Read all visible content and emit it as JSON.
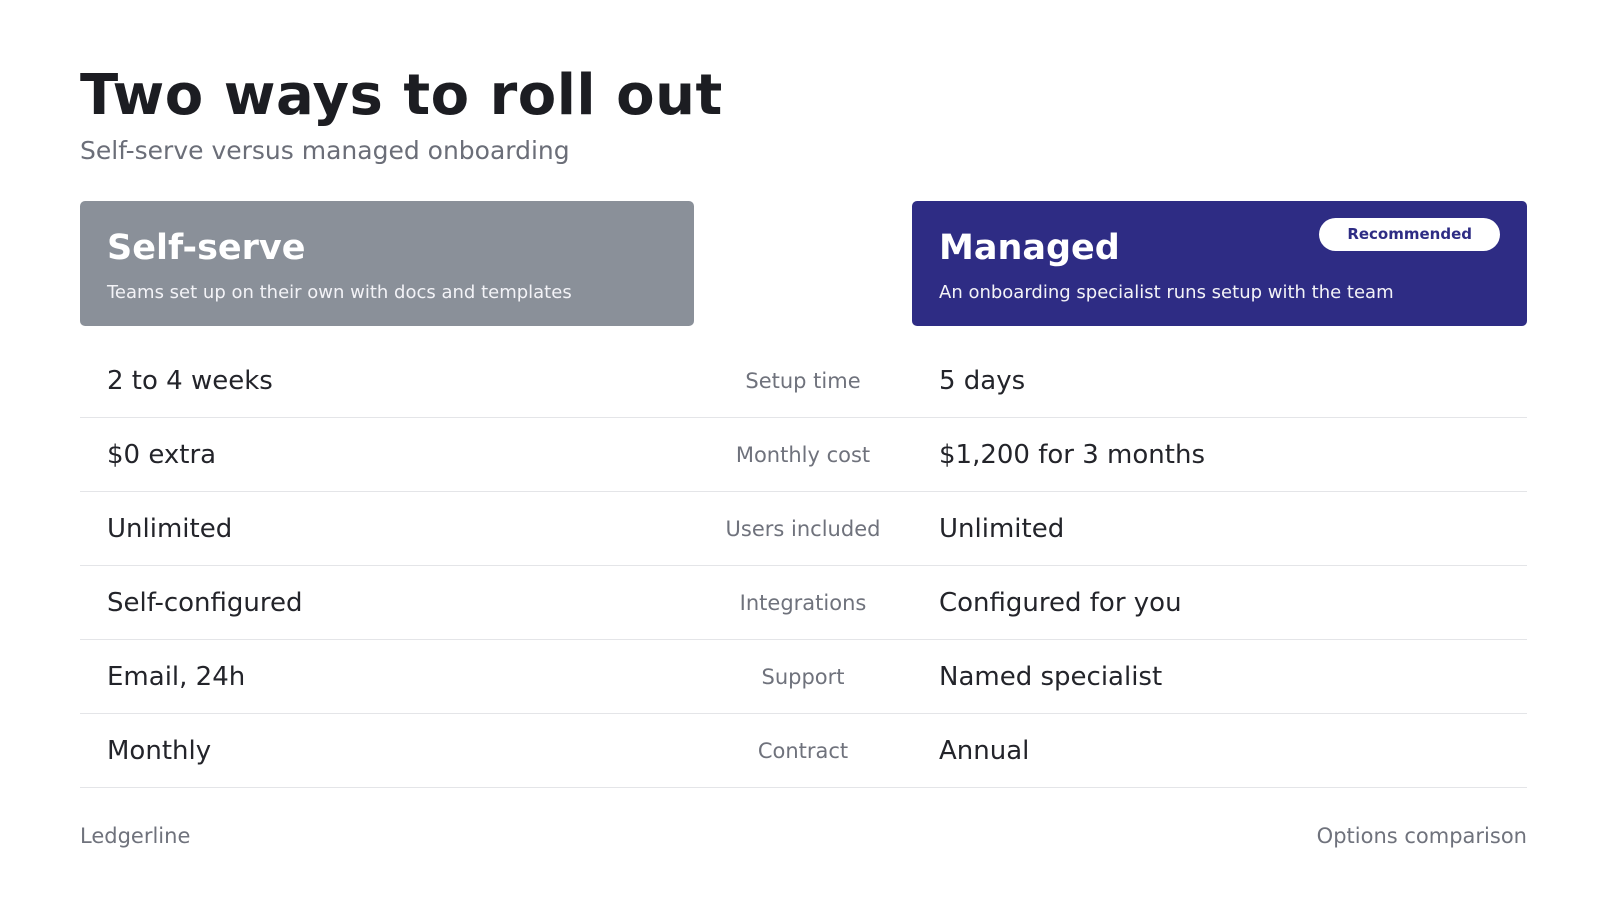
{
  "header": {
    "title": "Two ways to roll out",
    "subtitle": "Self-serve versus managed onboarding"
  },
  "options": {
    "left": {
      "title": "Self-serve",
      "description": "Teams set up on their own with docs and templates",
      "color": "#8a9099"
    },
    "right": {
      "title": "Managed",
      "description": "An onboarding specialist runs setup with the team",
      "badge": "Recommended",
      "color": "#2e2c84"
    }
  },
  "rows": [
    {
      "label": "Setup time",
      "left": "2 to 4 weeks",
      "right": "5 days"
    },
    {
      "label": "Monthly cost",
      "left": "$0 extra",
      "right": "$1,200 for 3 months"
    },
    {
      "label": "Users included",
      "left": "Unlimited",
      "right": "Unlimited"
    },
    {
      "label": "Integrations",
      "left": "Self-configured",
      "right": "Configured for you"
    },
    {
      "label": "Support",
      "left": "Email, 24h",
      "right": "Named specialist"
    },
    {
      "label": "Contract",
      "left": "Monthly",
      "right": "Annual"
    }
  ],
  "footer": {
    "brand": "Ledgerline",
    "section": "Options comparison"
  }
}
